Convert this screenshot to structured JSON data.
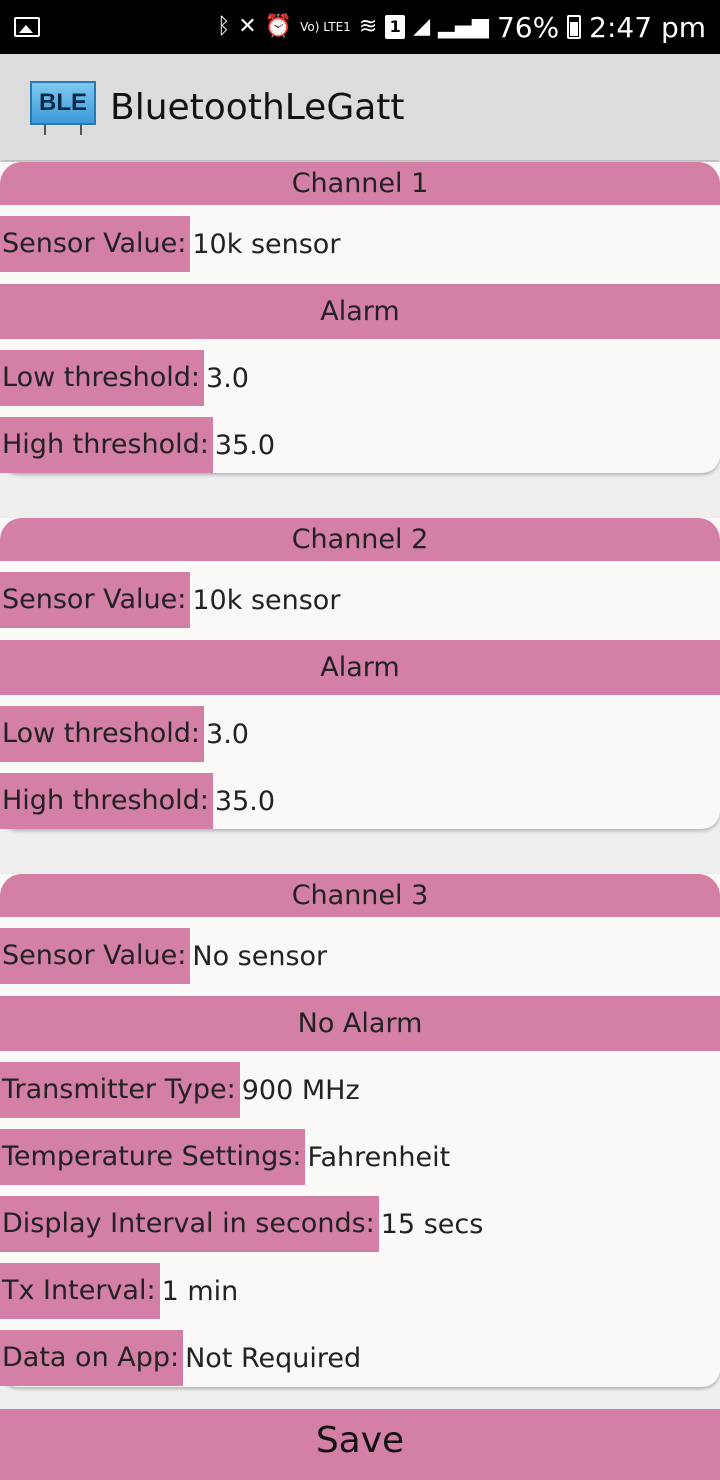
{
  "status_bar": {
    "lte_label": "Vo) LTE1",
    "sim_number": "1",
    "battery": "76%",
    "time": "2:47 pm"
  },
  "app_bar": {
    "logo_text": "BLE",
    "title": "BluetoothLeGatt"
  },
  "channels": [
    {
      "header": "Channel 1",
      "sensor_label": "Sensor Value:",
      "sensor_value": "10k sensor",
      "alarm_title": "Alarm",
      "low_label": "Low threshold:",
      "low_value": "3.0",
      "high_label": "High threshold:",
      "high_value": "35.0"
    },
    {
      "header": "Channel 2",
      "sensor_label": "Sensor Value:",
      "sensor_value": "10k sensor",
      "alarm_title": "Alarm",
      "low_label": "Low threshold:",
      "low_value": "3.0",
      "high_label": "High threshold:",
      "high_value": "35.0"
    },
    {
      "header": "Channel 3",
      "sensor_label": "Sensor Value:",
      "sensor_value": "No sensor",
      "alarm_title": "No Alarm"
    }
  ],
  "settings": [
    {
      "label": "Transmitter Type:",
      "value": "900 MHz"
    },
    {
      "label": "Temperature Settings:",
      "value": "Fahrenheit"
    },
    {
      "label": "Display Interval in seconds:",
      "value": "15 secs"
    },
    {
      "label": "Tx Interval:",
      "value": "1 min"
    },
    {
      "label": "Data on App:",
      "value": "Not Required"
    }
  ],
  "save_label": "Save",
  "colors": {
    "accent": "#d47fa6",
    "card_bg": "#fbf8f8",
    "page_bg": "#eeeeee",
    "appbar_bg": "#dcdcdc"
  }
}
